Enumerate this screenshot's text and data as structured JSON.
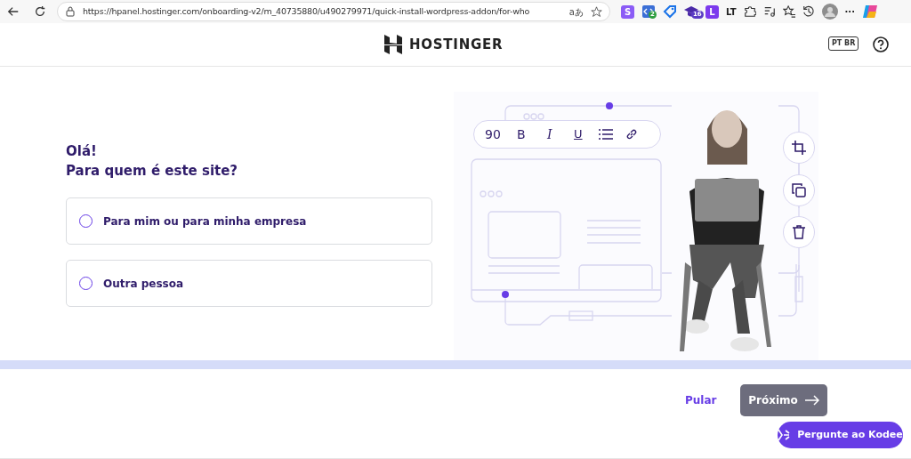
{
  "browser": {
    "url": "https://hpanel.hostinger.com/onboarding-v2/m_40735880/u490279971/quick-install-wordpress-addon/for-who",
    "translate_glyph": "aあ",
    "extensions": [
      {
        "kind": "letter",
        "label": "S",
        "color": "#8b5cf6"
      },
      {
        "kind": "code",
        "badge": "2"
      },
      {
        "kind": "tag"
      },
      {
        "kind": "hat",
        "badge": "16"
      },
      {
        "kind": "letter",
        "label": "L",
        "color": "#7c3aed"
      },
      {
        "kind": "text",
        "label": "LT"
      },
      {
        "kind": "puzzle"
      },
      {
        "kind": "media"
      },
      {
        "kind": "favorites"
      },
      {
        "kind": "history"
      },
      {
        "kind": "avatar"
      },
      {
        "kind": "more",
        "label": "···"
      },
      {
        "kind": "copilot"
      }
    ]
  },
  "header": {
    "brand": "HOSTINGER",
    "language": "PT BR"
  },
  "question": {
    "greeting": "Olá!",
    "title": "Para quem é este site?",
    "options": [
      {
        "label": "Para mim ou para minha empresa",
        "selected": false
      },
      {
        "label": "Outra pessoa",
        "selected": false
      }
    ]
  },
  "illustration": {
    "toolbar_value": "90",
    "toolbar_letters": [
      "B",
      "I",
      "U"
    ]
  },
  "footer": {
    "skip": "Pular",
    "next": {
      "label": "Próximo",
      "disabled": true
    },
    "assistant": "Pergunte ao Kodee"
  }
}
